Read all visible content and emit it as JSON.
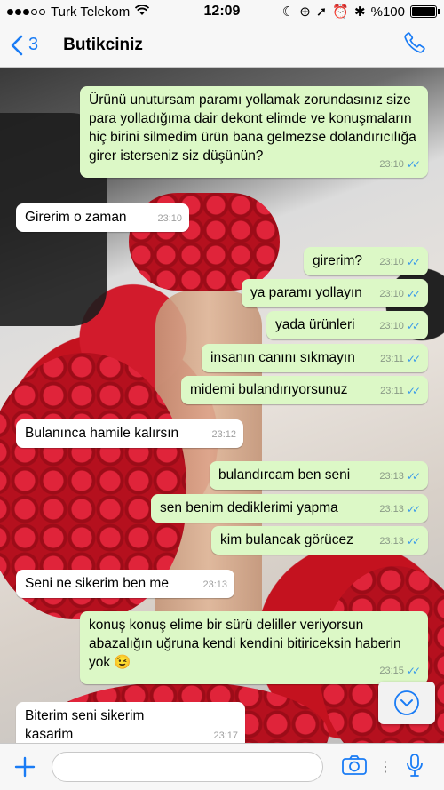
{
  "status": {
    "carrier": "Turk Telekom",
    "time": "12:09",
    "battery": "%100",
    "battery_level": 1.0
  },
  "header": {
    "back_count": "3",
    "contact_name": "Butikciniz"
  },
  "messages": [
    {
      "dir": "out",
      "text": "Ürünü unutursam paramı yollamak zorundasınız size para yolladığıma dair dekont elimde ve konuşmaların hiç birini silmedim ürün bana gelmezse dolandırıcılığa girer isterseniz siz düşünün?",
      "time": "23:10"
    },
    {
      "dir": "in",
      "text": "Girerim o zaman",
      "time": "23:10"
    },
    {
      "dir": "out",
      "text": "girerim?",
      "time": "23:10"
    },
    {
      "dir": "out",
      "text": "ya paramı yollayın",
      "time": "23:10"
    },
    {
      "dir": "out",
      "text": "yada ürünleri",
      "time": "23:10"
    },
    {
      "dir": "out",
      "text": "insanın canını sıkmayın",
      "time": "23:11"
    },
    {
      "dir": "out",
      "text": "midemi bulandırıyorsunuz",
      "time": "23:11"
    },
    {
      "dir": "in",
      "text": "Bulanınca hamile kalırsın",
      "time": "23:12"
    },
    {
      "dir": "out",
      "text": "bulandırcam ben seni",
      "time": "23:13"
    },
    {
      "dir": "out",
      "text": "sen benim dediklerimi yapma",
      "time": "23:13"
    },
    {
      "dir": "out",
      "text": "kim bulancak görücez",
      "time": "23:13"
    },
    {
      "dir": "in",
      "text": "Seni ne sikerim ben me",
      "time": "23:13"
    },
    {
      "dir": "out",
      "text": "konuş konuş elime bir sürü deliller veriyorsun abazalığın uğruna kendi kendini bitiriceksin haberin yok 😉",
      "time": "23:15"
    },
    {
      "dir": "in",
      "text": "Biterim seni sikerim kasarim",
      "time": "23:17"
    }
  ],
  "composer": {
    "input_value": "",
    "input_placeholder": ""
  },
  "icons": [
    "chevron-left-icon",
    "phone-icon",
    "plus-icon",
    "camera-icon",
    "microphone-icon",
    "chevron-down-icon",
    "wifi-icon",
    "alarm-icon",
    "moon-icon"
  ],
  "colors": {
    "accent": "#1a7cf5",
    "outgoing_bubble": "#dcf8c6",
    "incoming_bubble": "#ffffff",
    "read_ticks": "#3f9ce8"
  }
}
